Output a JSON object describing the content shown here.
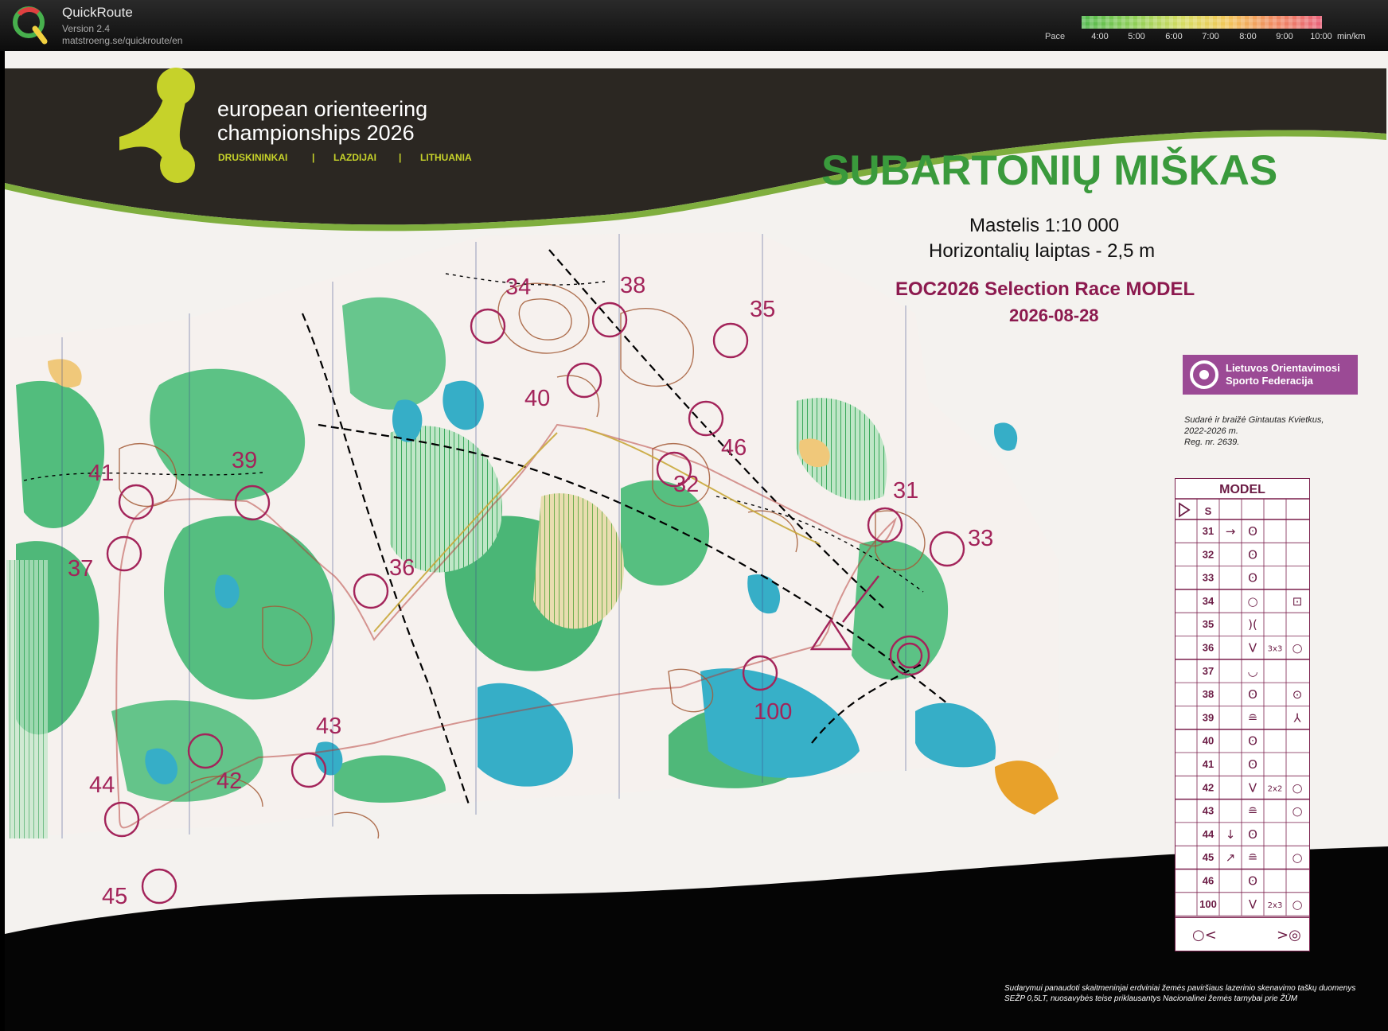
{
  "app": {
    "name": "QuickRoute",
    "version": "Version 2.4",
    "url": "matstroeng.se/quickroute/en"
  },
  "pace_legend": {
    "label": "Pace",
    "ticks": [
      "4:00",
      "5:00",
      "6:00",
      "7:00",
      "8:00",
      "9:00",
      "10:00"
    ],
    "unit": "min/km",
    "colors": [
      "#52b84d",
      "#8fcf57",
      "#d6dc63",
      "#f2c85a",
      "#f08a60",
      "#e9627a"
    ]
  },
  "map": {
    "event_logo": {
      "line1": "european orienteering",
      "line2": "championships 2026",
      "places": [
        "DRUSKININKAI",
        "LAZDIJAI",
        "LITHUANIA"
      ],
      "separator": "|"
    },
    "title": "SUBARTONIŲ MIŠKAS",
    "scale": "Mastelis  1:10 000",
    "contour_interval": "Horizontalių laiptas - 2,5 m",
    "race_name": "EOC2026 Selection Race MODEL",
    "race_date": "2026-08-28",
    "federation": {
      "line1": "Lietuvos Orientavimosi",
      "line2": "Sporto Federacija"
    },
    "credits": [
      "Sudarė ir braižė Gintautas Kvietkus,",
      "2022-2026 m.",
      "Reg. nr. 2639."
    ],
    "controls": [
      {
        "label": "31"
      },
      {
        "label": "32"
      },
      {
        "label": "33"
      },
      {
        "label": "34"
      },
      {
        "label": "35"
      },
      {
        "label": "36"
      },
      {
        "label": "37"
      },
      {
        "label": "38"
      },
      {
        "label": "39"
      },
      {
        "label": "40"
      },
      {
        "label": "41"
      },
      {
        "label": "42"
      },
      {
        "label": "43"
      },
      {
        "label": "44"
      },
      {
        "label": "45"
      },
      {
        "label": "46"
      },
      {
        "label": "100"
      }
    ],
    "control_descriptions": {
      "title": "MODEL",
      "header_code": "S",
      "rows": [
        {
          "code": "31",
          "direction": "→",
          "feature": "ʘ",
          "dims": "",
          "position": ""
        },
        {
          "code": "32",
          "direction": "",
          "feature": "ʘ",
          "dims": "",
          "position": ""
        },
        {
          "code": "33",
          "direction": "",
          "feature": "ʘ",
          "dims": "",
          "position": ""
        },
        {
          "code": "34",
          "direction": "",
          "feature": "○",
          "dims": "",
          "position": "⊡"
        },
        {
          "code": "35",
          "direction": "",
          "feature": ")(",
          "dims": "",
          "position": ""
        },
        {
          "code": "36",
          "direction": "",
          "feature": "V",
          "dims": "3x3",
          "position": "○"
        },
        {
          "code": "37",
          "direction": "",
          "feature": "◡",
          "dims": "",
          "position": ""
        },
        {
          "code": "38",
          "direction": "",
          "feature": "ʘ",
          "dims": "",
          "position": "⊙"
        },
        {
          "code": "39",
          "direction": "",
          "feature": "≘",
          "dims": "",
          "position": "⅄"
        },
        {
          "code": "40",
          "direction": "",
          "feature": "ʘ",
          "dims": "",
          "position": ""
        },
        {
          "code": "41",
          "direction": "",
          "feature": "ʘ",
          "dims": "",
          "position": ""
        },
        {
          "code": "42",
          "direction": "",
          "feature": "V",
          "dims": "2x2",
          "position": "○"
        },
        {
          "code": "43",
          "direction": "",
          "feature": "≘",
          "dims": "",
          "position": "○"
        },
        {
          "code": "44",
          "direction": "↓",
          "feature": "ʘ",
          "dims": "",
          "position": ""
        },
        {
          "code": "45",
          "direction": "↗",
          "feature": "≘",
          "dims": "",
          "position": "○"
        },
        {
          "code": "46",
          "direction": "",
          "feature": "ʘ",
          "dims": "",
          "position": ""
        },
        {
          "code": "100",
          "direction": "",
          "feature": "V",
          "dims": "2x3",
          "position": "○"
        }
      ],
      "finish_left": "○<",
      "finish_right": ">◎"
    },
    "lidar_note": [
      "Sudarymui panaudoti skaitmeninjai erdviniai žemės paviršiaus lazerinio skenavimo taškų duomenys",
      "SEŽP 0,5LT, nuosavybės teise priklausantys Nacionalinei žemės tarnybai prie ŽŪM"
    ],
    "colors": {
      "control_purple": "#a3245a",
      "header_green": "#3a9a3c",
      "header_dark": "#2b2722",
      "logo_lime": "#c6d22a",
      "vegetation_green": "#4dba7a",
      "water_blue": "#34aec6",
      "route_red": "#b3342f",
      "contour_brown": "#a0522d",
      "federation_purple": "#9b4a95"
    }
  }
}
